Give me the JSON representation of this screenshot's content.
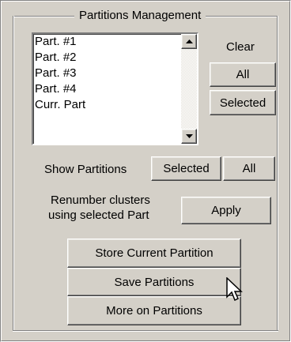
{
  "group_title": "Partitions Management",
  "partitions": [
    "Part. #1",
    "Part. #2",
    "Part. #3",
    "Part. #4",
    "Curr. Part"
  ],
  "clear": {
    "label": "Clear",
    "all_button": "All",
    "selected_button": "Selected"
  },
  "show_partitions": {
    "label": "Show Partitions",
    "selected_button": "Selected",
    "all_button": "All"
  },
  "renumber": {
    "line1": "Renumber clusters",
    "line2": "using selected Part",
    "apply_button": "Apply"
  },
  "actions": {
    "store": "Store Current Partition",
    "save": "Save Partitions",
    "more": "More on Partitions"
  },
  "icons": {
    "scroll_up": "triangle-up",
    "scroll_down": "triangle-down",
    "cursor": "arrow-pointer"
  }
}
